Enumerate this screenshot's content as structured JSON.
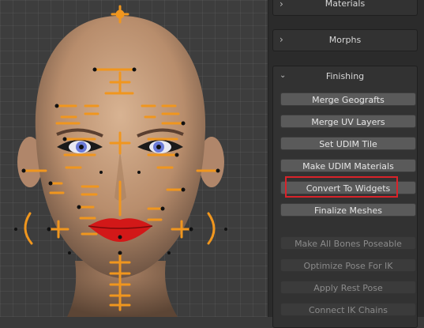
{
  "panel": {
    "materials": {
      "title": "Materials",
      "chevron_icon": "chevron-right-icon"
    },
    "morphs": {
      "title": "Morphs",
      "chevron_icon": "chevron-right-icon"
    },
    "finishing": {
      "title": "Finishing",
      "chevron_icon": "chevron-down-icon",
      "buttons": [
        {
          "label": "Merge Geografts",
          "enabled": true
        },
        {
          "label": "Merge UV Layers",
          "enabled": true
        },
        {
          "label": "Set UDIM Tile",
          "enabled": true
        },
        {
          "label": "Make UDIM Materials",
          "enabled": true
        },
        {
          "label": "Convert To Widgets",
          "enabled": true,
          "highlighted": true
        },
        {
          "label": "Finalize Meshes",
          "enabled": true
        },
        {
          "label": "Make All Bones Poseable",
          "enabled": false
        },
        {
          "label": "Optimize Pose For IK",
          "enabled": false
        },
        {
          "label": "Apply Rest Pose",
          "enabled": false
        },
        {
          "label": "Connect IK Chains",
          "enabled": false
        }
      ]
    }
  },
  "colors": {
    "highlight": "#d9232a",
    "bone_widget": "#f0961e",
    "skin": "#c9a07f",
    "lips": "#d21818"
  },
  "viewport": {
    "content": "3D head model with face rig bone widgets"
  }
}
